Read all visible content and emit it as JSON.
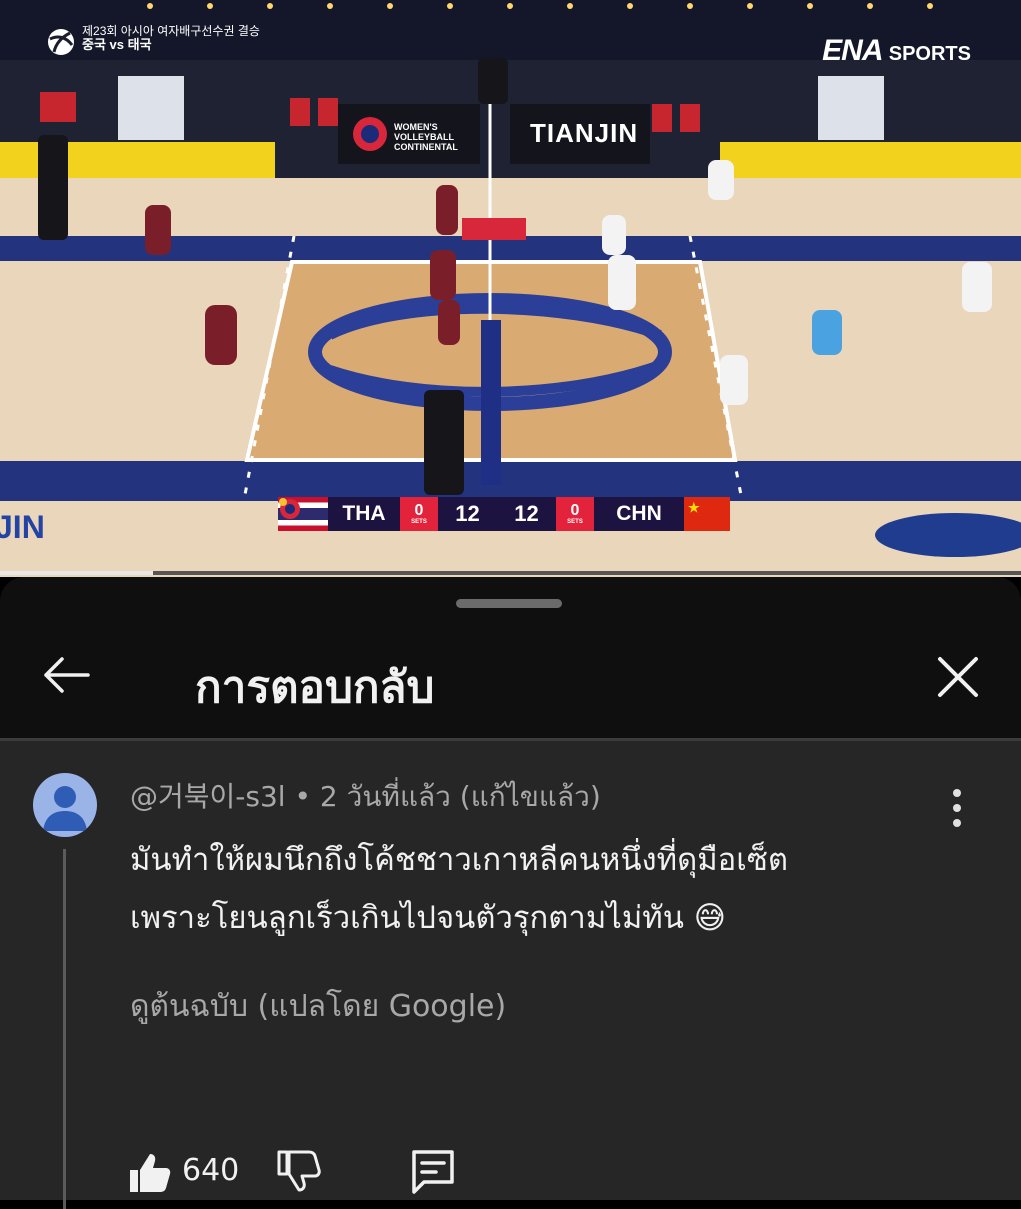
{
  "video": {
    "event_title": "제23회 아시아 여자배구선수권 결승",
    "event_subtitle": "중국 vs 태국",
    "broadcaster": "ENA",
    "broadcaster_suffix": "SPORTS",
    "board_venue": "TIANJIN",
    "board_sponsor": "WOMEN'S VOLLEYBALL CONTINENTAL",
    "scoreboard": {
      "home_team": "THA",
      "home_sets": "0",
      "home_points": "12",
      "away_points": "12",
      "away_sets": "0",
      "away_team": "CHN",
      "sets_label": "SETS"
    },
    "progress_fraction": 0.15
  },
  "panel": {
    "title": "การตอบกลับ",
    "back_icon": "arrow-left-icon",
    "close_icon": "close-icon"
  },
  "comment": {
    "author": "@거북이-s3l",
    "separator": "•",
    "time": "2 วันที่แล้ว",
    "edited": "(แก้ไขแล้ว)",
    "text_line1": "มันทำให้ผมนึกถึงโค้ชชาวเกาหลีคนหนึ่งที่ดุมือเซ็ต",
    "text_line2": "เพราะโยนลูกเร็วเกินไปจนตัวรุกตามไม่ทัน",
    "emoji": "😅",
    "translation_link": "ดูต้นฉบับ (แปลโดย Google)",
    "likes": "640"
  },
  "colors": {
    "panel_bg": "#262626",
    "header_bg": "#0f0f0f",
    "avatar_bg": "#9ab4e8",
    "muted_text": "#a8a8a8",
    "court_blue": "#23337d"
  }
}
